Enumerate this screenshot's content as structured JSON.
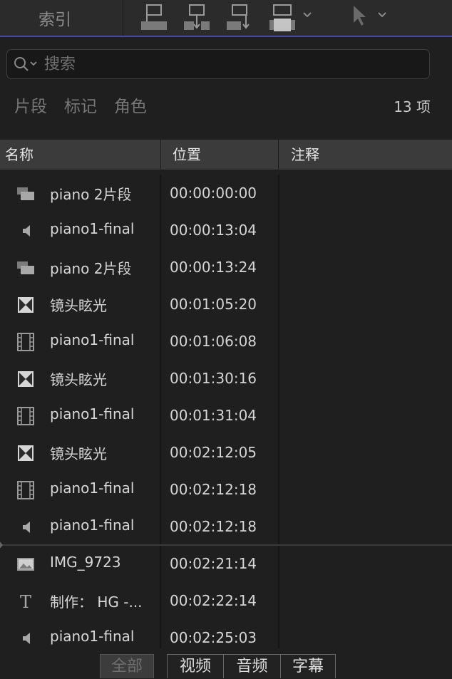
{
  "toolbar": {
    "index_label": "索引",
    "buttons": [
      "connect-clip-icon",
      "insert-clip-icon",
      "append-clip-icon",
      "overwrite-clip-icon"
    ],
    "tool": "select-arrow-icon"
  },
  "search": {
    "placeholder": "搜索",
    "value": ""
  },
  "filters": {
    "clips": "片段",
    "tags": "标记",
    "roles": "角色",
    "count": "13 项"
  },
  "columns": {
    "name": "名称",
    "position": "位置",
    "notes": "注释"
  },
  "rows": [
    {
      "icon": "compound-clip-icon",
      "name": "piano 2片段",
      "position": "00:00:00:00"
    },
    {
      "icon": "audio-icon",
      "name": "piano1-final",
      "position": "00:00:13:04"
    },
    {
      "icon": "compound-clip-icon",
      "name": "piano 2片段",
      "position": "00:00:13:24"
    },
    {
      "icon": "transition-icon",
      "name": "镜头眩光",
      "position": "00:01:05:20"
    },
    {
      "icon": "film-icon",
      "name": "piano1-final",
      "position": "00:01:06:08"
    },
    {
      "icon": "transition-icon",
      "name": "镜头眩光",
      "position": "00:01:30:16"
    },
    {
      "icon": "film-icon",
      "name": "piano1-final",
      "position": "00:01:31:04"
    },
    {
      "icon": "transition-icon",
      "name": "镜头眩光",
      "position": "00:02:12:05"
    },
    {
      "icon": "film-icon",
      "name": "piano1-final",
      "position": "00:02:12:18"
    },
    {
      "icon": "audio-icon",
      "name": "piano1-final",
      "position": "00:02:12:18"
    },
    {
      "icon": "image-icon",
      "name": "IMG_9723",
      "position": "00:02:21:14"
    },
    {
      "icon": "title-icon",
      "name": "制作： HG -...",
      "position": "00:02:22:14"
    },
    {
      "icon": "audio-icon",
      "name": "piano1-final",
      "position": "00:02:25:03"
    }
  ],
  "bottom_tabs": {
    "all": "全部",
    "video": "视频",
    "audio": "音频",
    "captions": "字幕"
  }
}
